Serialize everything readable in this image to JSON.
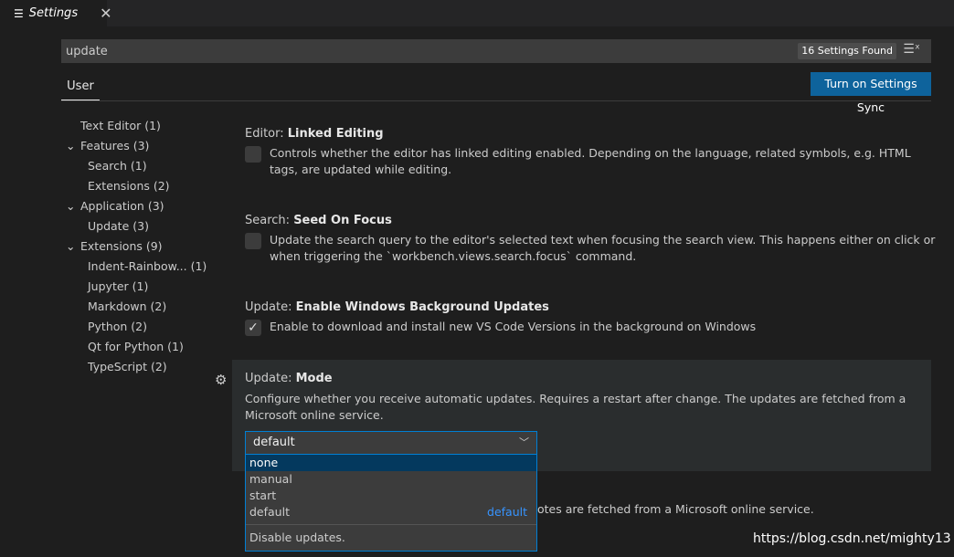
{
  "tab": {
    "title": "Settings",
    "close": "✕"
  },
  "search": {
    "value": "update",
    "found": "16 Settings Found"
  },
  "header": {
    "user_tab": "User",
    "sync_button": "Turn on Settings Sync"
  },
  "tree": [
    {
      "label": "Text Editor (1)",
      "level": 0,
      "expanded": null
    },
    {
      "label": "Features (3)",
      "level": 0,
      "expanded": true
    },
    {
      "label": "Search (1)",
      "level": 1
    },
    {
      "label": "Extensions (2)",
      "level": 1
    },
    {
      "label": "Application (3)",
      "level": 0,
      "expanded": true
    },
    {
      "label": "Update (3)",
      "level": 1
    },
    {
      "label": "Extensions (9)",
      "level": 0,
      "expanded": true
    },
    {
      "label": "Indent-Rainbow...  (1)",
      "level": 1
    },
    {
      "label": "Jupyter (1)",
      "level": 1
    },
    {
      "label": "Markdown (2)",
      "level": 1
    },
    {
      "label": "Python (2)",
      "level": 1
    },
    {
      "label": "Qt for Python (1)",
      "level": 1
    },
    {
      "label": "TypeScript (2)",
      "level": 1
    }
  ],
  "settings": [
    {
      "category": "Editor: ",
      "name": "Linked Editing",
      "desc": "Controls whether the editor has linked editing enabled. Depending on the language, related symbols, e.g. HTML tags, are updated while editing.",
      "checked": false
    },
    {
      "category": "Search: ",
      "name": "Seed On Focus",
      "desc": "Update the search query to the editor's selected text when focusing the search view. This happens either on click or when triggering the `workbench.views.search.focus` command.",
      "checked": false
    },
    {
      "category": "Update: ",
      "name": "Enable Windows Background Updates",
      "desc": "Enable to download and install new VS Code Versions in the background on Windows",
      "checked": true
    },
    {
      "category": "Update: ",
      "name": "Mode",
      "desc": "Configure whether you receive automatic updates. Requires a restart after change. The updates are fetched from a Microsoft online service.",
      "value": "default"
    }
  ],
  "dropdown": {
    "options": [
      "none",
      "manual",
      "start",
      "default"
    ],
    "highlighted": "none",
    "default_tag": "default",
    "option_desc": "Disable updates."
  },
  "behind_text": "otes are fetched from a Microsoft online service.",
  "watermark": "https://blog.csdn.net/mighty13",
  "colors": {
    "accent": "#007fd4",
    "sync_button": "#0e639c",
    "selected_option": "#04395e"
  }
}
